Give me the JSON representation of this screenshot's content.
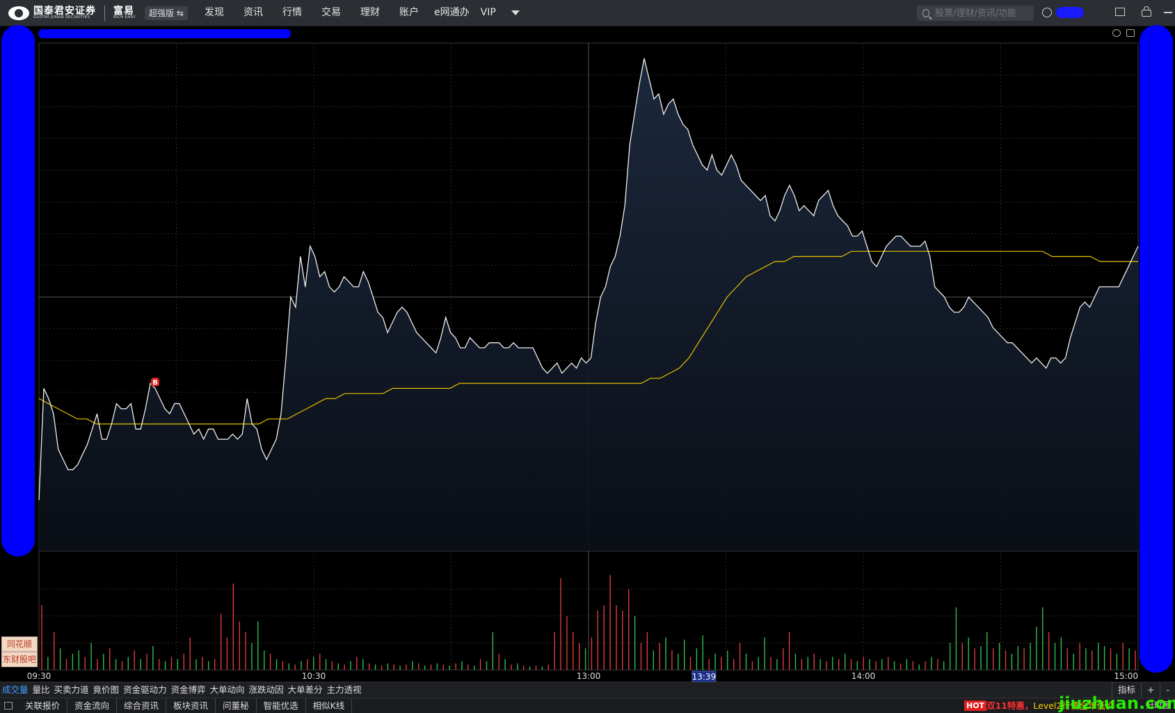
{
  "app": {
    "brand_cn": "国泰君安证券",
    "brand_en": "GUOTAI JUNAN SECURITIES",
    "product_cn": "富易",
    "product_en": "RICH EASY",
    "edition": "超强版 ⇆"
  },
  "nav": [
    "发现",
    "资讯",
    "行情",
    "交易",
    "理财",
    "账户",
    "e网通办",
    "VIP"
  ],
  "search": {
    "placeholder": "股票/理财/资讯/功能"
  },
  "chart_data": {
    "type": "line",
    "x_ticks": [
      "09:30",
      "10:30",
      "13:00",
      "14:00",
      "15:00"
    ],
    "cursor_time": "13:39",
    "marker": "B",
    "price_points": [
      0.1,
      0.32,
      0.3,
      0.27,
      0.2,
      0.18,
      0.16,
      0.16,
      0.17,
      0.19,
      0.21,
      0.24,
      0.27,
      0.22,
      0.22,
      0.25,
      0.29,
      0.28,
      0.28,
      0.29,
      0.24,
      0.24,
      0.28,
      0.33,
      0.32,
      0.3,
      0.28,
      0.27,
      0.29,
      0.29,
      0.27,
      0.25,
      0.23,
      0.24,
      0.22,
      0.24,
      0.24,
      0.22,
      0.22,
      0.22,
      0.23,
      0.22,
      0.23,
      0.3,
      0.25,
      0.24,
      0.2,
      0.18,
      0.2,
      0.22,
      0.27,
      0.38,
      0.5,
      0.48,
      0.58,
      0.52,
      0.6,
      0.58,
      0.54,
      0.55,
      0.52,
      0.51,
      0.52,
      0.54,
      0.53,
      0.52,
      0.52,
      0.55,
      0.53,
      0.5,
      0.47,
      0.46,
      0.43,
      0.45,
      0.47,
      0.48,
      0.47,
      0.45,
      0.43,
      0.42,
      0.41,
      0.4,
      0.39,
      0.42,
      0.46,
      0.43,
      0.42,
      0.4,
      0.4,
      0.42,
      0.41,
      0.4,
      0.4,
      0.41,
      0.41,
      0.41,
      0.4,
      0.4,
      0.41,
      0.4,
      0.4,
      0.4,
      0.4,
      0.38,
      0.36,
      0.35,
      0.36,
      0.37,
      0.35,
      0.36,
      0.37,
      0.36,
      0.38,
      0.37,
      0.38,
      0.45,
      0.5,
      0.52,
      0.56,
      0.58,
      0.62,
      0.68,
      0.8,
      0.86,
      0.92,
      0.97,
      0.93,
      0.89,
      0.9,
      0.86,
      0.88,
      0.89,
      0.86,
      0.84,
      0.83,
      0.8,
      0.78,
      0.76,
      0.75,
      0.78,
      0.75,
      0.74,
      0.76,
      0.78,
      0.76,
      0.73,
      0.72,
      0.71,
      0.7,
      0.69,
      0.7,
      0.66,
      0.65,
      0.67,
      0.7,
      0.72,
      0.7,
      0.67,
      0.68,
      0.67,
      0.66,
      0.69,
      0.7,
      0.71,
      0.68,
      0.66,
      0.65,
      0.64,
      0.62,
      0.62,
      0.63,
      0.6,
      0.57,
      0.56,
      0.58,
      0.6,
      0.61,
      0.62,
      0.62,
      0.61,
      0.6,
      0.6,
      0.6,
      0.61,
      0.58,
      0.52,
      0.51,
      0.5,
      0.48,
      0.47,
      0.47,
      0.48,
      0.5,
      0.49,
      0.48,
      0.47,
      0.46,
      0.44,
      0.43,
      0.42,
      0.41,
      0.41,
      0.4,
      0.39,
      0.38,
      0.37,
      0.38,
      0.37,
      0.36,
      0.38,
      0.38,
      0.37,
      0.38,
      0.42,
      0.45,
      0.48,
      0.49,
      0.48,
      0.5,
      0.52,
      0.52,
      0.52,
      0.52,
      0.52,
      0.54,
      0.56,
      0.58,
      0.6
    ],
    "avg_points": [
      0.3,
      0.29,
      0.28,
      0.27,
      0.26,
      0.26,
      0.25,
      0.25,
      0.25,
      0.25,
      0.25,
      0.25,
      0.25,
      0.25,
      0.25,
      0.25,
      0.25,
      0.25,
      0.25,
      0.25,
      0.25,
      0.25,
      0.25,
      0.25,
      0.26,
      0.26,
      0.26,
      0.27,
      0.28,
      0.29,
      0.3,
      0.3,
      0.31,
      0.31,
      0.31,
      0.31,
      0.31,
      0.32,
      0.32,
      0.32,
      0.32,
      0.32,
      0.32,
      0.32,
      0.33,
      0.33,
      0.33,
      0.33,
      0.33,
      0.33,
      0.33,
      0.33,
      0.33,
      0.33,
      0.33,
      0.33,
      0.33,
      0.33,
      0.33,
      0.33,
      0.33,
      0.33,
      0.33,
      0.33,
      0.34,
      0.34,
      0.35,
      0.36,
      0.38,
      0.41,
      0.44,
      0.47,
      0.5,
      0.52,
      0.54,
      0.55,
      0.56,
      0.57,
      0.57,
      0.58,
      0.58,
      0.58,
      0.58,
      0.58,
      0.58,
      0.59,
      0.59,
      0.59,
      0.59,
      0.59,
      0.59,
      0.59,
      0.59,
      0.59,
      0.59,
      0.59,
      0.59,
      0.59,
      0.59,
      0.59,
      0.59,
      0.59,
      0.59,
      0.59,
      0.59,
      0.59,
      0.58,
      0.58,
      0.58,
      0.58,
      0.58,
      0.57,
      0.57,
      0.57,
      0.57,
      0.57
    ],
    "volume_bars": [
      [
        0.6,
        "r"
      ],
      [
        0.12,
        "g"
      ],
      [
        0.35,
        "r"
      ],
      [
        0.2,
        "g"
      ],
      [
        0.1,
        "r"
      ],
      [
        0.15,
        "g"
      ],
      [
        0.18,
        "g"
      ],
      [
        0.12,
        "r"
      ],
      [
        0.25,
        "g"
      ],
      [
        0.1,
        "r"
      ],
      [
        0.15,
        "g"
      ],
      [
        0.2,
        "r"
      ],
      [
        0.1,
        "g"
      ],
      [
        0.08,
        "r"
      ],
      [
        0.12,
        "g"
      ],
      [
        0.18,
        "r"
      ],
      [
        0.1,
        "g"
      ],
      [
        0.15,
        "r"
      ],
      [
        0.22,
        "g"
      ],
      [
        0.1,
        "r"
      ],
      [
        0.08,
        "g"
      ],
      [
        0.12,
        "r"
      ],
      [
        0.1,
        "g"
      ],
      [
        0.15,
        "r"
      ],
      [
        0.3,
        "r"
      ],
      [
        0.1,
        "g"
      ],
      [
        0.12,
        "r"
      ],
      [
        0.08,
        "g"
      ],
      [
        0.1,
        "r"
      ],
      [
        0.52,
        "r"
      ],
      [
        0.3,
        "r"
      ],
      [
        0.8,
        "r"
      ],
      [
        0.45,
        "r"
      ],
      [
        0.35,
        "r"
      ],
      [
        0.25,
        "g"
      ],
      [
        0.45,
        "g"
      ],
      [
        0.18,
        "g"
      ],
      [
        0.15,
        "r"
      ],
      [
        0.1,
        "g"
      ],
      [
        0.08,
        "r"
      ],
      [
        0.06,
        "g"
      ],
      [
        0.05,
        "r"
      ],
      [
        0.08,
        "g"
      ],
      [
        0.1,
        "r"
      ],
      [
        0.12,
        "g"
      ],
      [
        0.15,
        "r"
      ],
      [
        0.1,
        "g"
      ],
      [
        0.08,
        "r"
      ],
      [
        0.06,
        "g"
      ],
      [
        0.05,
        "r"
      ],
      [
        0.08,
        "g"
      ],
      [
        0.12,
        "r"
      ],
      [
        0.1,
        "g"
      ],
      [
        0.06,
        "r"
      ],
      [
        0.05,
        "g"
      ],
      [
        0.04,
        "r"
      ],
      [
        0.06,
        "g"
      ],
      [
        0.05,
        "r"
      ],
      [
        0.04,
        "g"
      ],
      [
        0.05,
        "r"
      ],
      [
        0.08,
        "g"
      ],
      [
        0.06,
        "r"
      ],
      [
        0.04,
        "g"
      ],
      [
        0.05,
        "r"
      ],
      [
        0.06,
        "g"
      ],
      [
        0.05,
        "r"
      ],
      [
        0.04,
        "g"
      ],
      [
        0.06,
        "r"
      ],
      [
        0.08,
        "g"
      ],
      [
        0.05,
        "r"
      ],
      [
        0.04,
        "g"
      ],
      [
        0.1,
        "r"
      ],
      [
        0.08,
        "g"
      ],
      [
        0.35,
        "g"
      ],
      [
        0.15,
        "r"
      ],
      [
        0.1,
        "g"
      ],
      [
        0.05,
        "r"
      ],
      [
        0.06,
        "g"
      ],
      [
        0.04,
        "r"
      ],
      [
        0.03,
        "g"
      ],
      [
        0.04,
        "r"
      ],
      [
        0.03,
        "g"
      ],
      [
        0.05,
        "r"
      ],
      [
        0.35,
        "r"
      ],
      [
        0.85,
        "r"
      ],
      [
        0.5,
        "r"
      ],
      [
        0.35,
        "r"
      ],
      [
        0.25,
        "r"
      ],
      [
        0.2,
        "g"
      ],
      [
        0.3,
        "r"
      ],
      [
        0.55,
        "r"
      ],
      [
        0.6,
        "r"
      ],
      [
        0.88,
        "r"
      ],
      [
        0.6,
        "r"
      ],
      [
        0.55,
        "r"
      ],
      [
        0.75,
        "r"
      ],
      [
        0.5,
        "g"
      ],
      [
        0.25,
        "r"
      ],
      [
        0.35,
        "r"
      ],
      [
        0.18,
        "g"
      ],
      [
        0.25,
        "r"
      ],
      [
        0.3,
        "g"
      ],
      [
        0.18,
        "r"
      ],
      [
        0.15,
        "g"
      ],
      [
        0.28,
        "g"
      ],
      [
        0.12,
        "r"
      ],
      [
        0.2,
        "g"
      ],
      [
        0.32,
        "g"
      ],
      [
        0.1,
        "r"
      ],
      [
        0.15,
        "g"
      ],
      [
        0.12,
        "r"
      ],
      [
        0.18,
        "g"
      ],
      [
        0.1,
        "r"
      ],
      [
        0.25,
        "r"
      ],
      [
        0.15,
        "g"
      ],
      [
        0.08,
        "r"
      ],
      [
        0.12,
        "g"
      ],
      [
        0.3,
        "g"
      ],
      [
        0.12,
        "r"
      ],
      [
        0.1,
        "g"
      ],
      [
        0.2,
        "r"
      ],
      [
        0.35,
        "r"
      ],
      [
        0.15,
        "g"
      ],
      [
        0.1,
        "r"
      ],
      [
        0.12,
        "g"
      ],
      [
        0.15,
        "r"
      ],
      [
        0.1,
        "g"
      ],
      [
        0.08,
        "r"
      ],
      [
        0.12,
        "g"
      ],
      [
        0.1,
        "r"
      ],
      [
        0.15,
        "g"
      ],
      [
        0.1,
        "r"
      ],
      [
        0.08,
        "g"
      ],
      [
        0.12,
        "r"
      ],
      [
        0.1,
        "g"
      ],
      [
        0.08,
        "r"
      ],
      [
        0.1,
        "g"
      ],
      [
        0.12,
        "r"
      ],
      [
        0.08,
        "g"
      ],
      [
        0.06,
        "r"
      ],
      [
        0.1,
        "g"
      ],
      [
        0.08,
        "r"
      ],
      [
        0.05,
        "g"
      ],
      [
        0.08,
        "r"
      ],
      [
        0.12,
        "g"
      ],
      [
        0.1,
        "r"
      ],
      [
        0.08,
        "g"
      ],
      [
        0.25,
        "g"
      ],
      [
        0.58,
        "g"
      ],
      [
        0.25,
        "r"
      ],
      [
        0.3,
        "g"
      ],
      [
        0.2,
        "r"
      ],
      [
        0.22,
        "g"
      ],
      [
        0.35,
        "g"
      ],
      [
        0.2,
        "r"
      ],
      [
        0.25,
        "g"
      ],
      [
        0.18,
        "r"
      ],
      [
        0.15,
        "g"
      ],
      [
        0.22,
        "g"
      ],
      [
        0.2,
        "r"
      ],
      [
        0.25,
        "g"
      ],
      [
        0.4,
        "g"
      ],
      [
        0.58,
        "g"
      ],
      [
        0.35,
        "r"
      ],
      [
        0.25,
        "g"
      ],
      [
        0.3,
        "g"
      ],
      [
        0.2,
        "r"
      ],
      [
        0.15,
        "g"
      ],
      [
        0.25,
        "r"
      ],
      [
        0.2,
        "g"
      ],
      [
        0.18,
        "r"
      ],
      [
        0.25,
        "g"
      ],
      [
        0.22,
        "g"
      ],
      [
        0.2,
        "r"
      ],
      [
        0.15,
        "g"
      ],
      [
        0.25,
        "r"
      ],
      [
        0.2,
        "g"
      ],
      [
        0.18,
        "r"
      ]
    ]
  },
  "side_tags": [
    "同花顺",
    "东财股吧"
  ],
  "tabs_row1": [
    "成交量",
    "量比",
    "买卖力道",
    "竟价图",
    "资金驱动力",
    "资金博弈",
    "大单动向",
    "涨跌动因",
    "大单差分",
    "主力透视"
  ],
  "tabs_row1_right": [
    "指标",
    "+",
    "-"
  ],
  "tabs_row2": [
    "关联报价",
    "资金流向",
    "综合资讯",
    "板块资讯",
    "问董秘",
    "智能优选",
    "相似K线"
  ],
  "promo": {
    "hot": "HOT",
    "text": "双11特惠，",
    "text2": "Level2行情全年低价"
  },
  "watermark": "jiuzhuan.com",
  "corner": "分时图"
}
